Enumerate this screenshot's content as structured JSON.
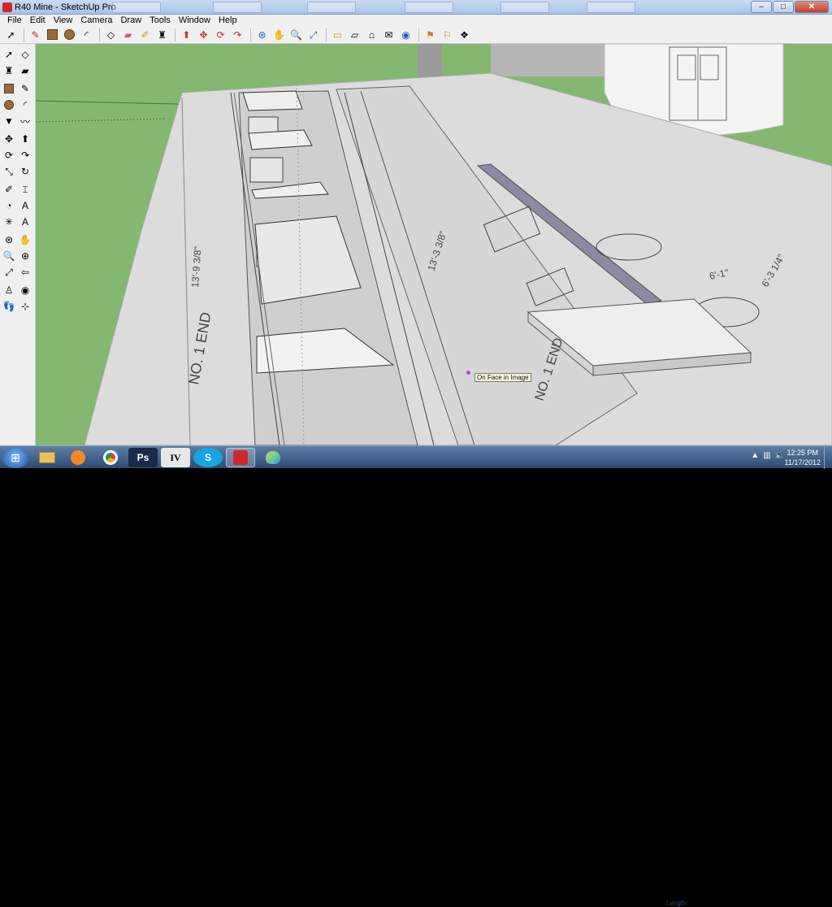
{
  "window": {
    "title": "R40 Mine - SketchUp Pro",
    "controls": {
      "minimize": "–",
      "maximize": "□",
      "close": "✕"
    }
  },
  "menubar": [
    "File",
    "Edit",
    "View",
    "Camera",
    "Draw",
    "Tools",
    "Window",
    "Help"
  ],
  "toolbar": {
    "icons": [
      "select-icon",
      "pencil-icon",
      "rectangle-icon",
      "circle-icon",
      "arc-icon",
      "eraser-icon",
      "paint-bucket-icon",
      "push-pull-icon",
      "follow-me-icon",
      "move-icon",
      "rotate-icon",
      "scale-icon",
      "offset-icon",
      "tape-measure-icon",
      "text-icon",
      "protractor-icon",
      "orbit-icon",
      "pan-icon",
      "zoom-icon",
      "zoom-extents-icon",
      "axes-icon",
      "dimension-icon",
      "section-plane-icon",
      "3d-text-icon",
      "walk-icon",
      "look-around-icon",
      "position-camera-icon",
      "components-icon",
      "add-location-icon",
      "warehouse-icon",
      "share-model-icon"
    ]
  },
  "viewport": {
    "tooltip": "On Face in Image",
    "drawing_labels": [
      "NO. 1 END",
      "NO. 1 END",
      "13'-9 3/8\"",
      "13'-9 3/8\"",
      "13'-3 3/8\"",
      "6'-1\"",
      "6'-3 1/4\""
    ],
    "colors": {
      "ground": "#84b870",
      "sky_fade": "#a9d28e",
      "paper": "#dcdcdc",
      "highlight": "#8a8aa3"
    }
  },
  "taskbar": {
    "apps": [
      {
        "name": "file-explorer-icon",
        "label": ""
      },
      {
        "name": "media-player-icon",
        "label": ""
      },
      {
        "name": "chrome-icon",
        "label": ""
      },
      {
        "name": "photoshop-icon",
        "label": "Ps"
      },
      {
        "name": "iv-app-icon",
        "label": "IV"
      },
      {
        "name": "skype-icon",
        "label": "S"
      },
      {
        "name": "sketchup-icon",
        "label": ""
      },
      {
        "name": "paint-icon",
        "label": ""
      }
    ],
    "clock_time": "12:25 PM",
    "clock_date": "11/17/2012",
    "ghost_label": "Length"
  }
}
